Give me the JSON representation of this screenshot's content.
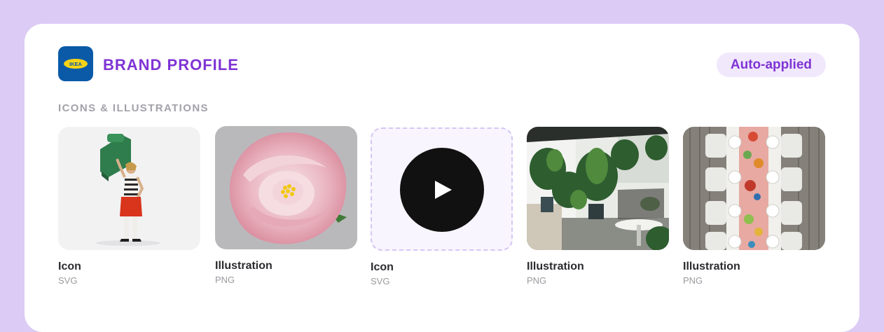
{
  "header": {
    "logo_text": "IKEA",
    "title": "BRAND PROFILE",
    "badge": "Auto-applied"
  },
  "section": {
    "label": "ICONS & ILLUSTRATIONS"
  },
  "assets": [
    {
      "title": "Icon",
      "type": "SVG",
      "thumb": "woman-carrying-green-chair"
    },
    {
      "title": "Illustration",
      "type": "PNG",
      "thumb": "pink-peony-flower"
    },
    {
      "title": "Icon",
      "type": "SVG",
      "thumb": "play-icon"
    },
    {
      "title": "Illustration",
      "type": "PNG",
      "thumb": "plants-patio-photo"
    },
    {
      "title": "Illustration",
      "type": "PNG",
      "thumb": "dining-table-top-view"
    }
  ],
  "colors": {
    "background": "#dccbf5",
    "accent": "#7f34d4",
    "badge_bg": "#f1e8fc",
    "ikea_blue": "#0a5aa8",
    "ikea_yellow": "#f7d416"
  }
}
